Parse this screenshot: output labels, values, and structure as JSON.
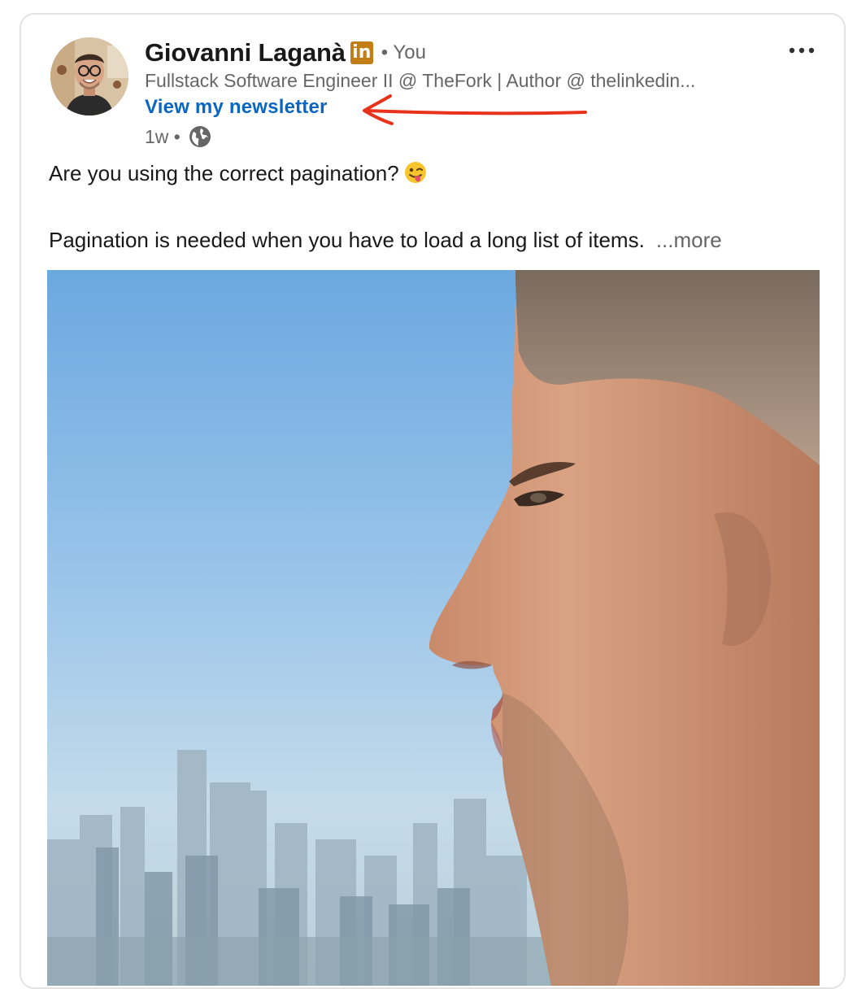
{
  "post": {
    "author": {
      "name": "Giovanni Laganà",
      "badge": "in",
      "degree": "• You",
      "headline": "Fullstack Software Engineer II @ TheFork | Author @ thelinkedin...",
      "newsletter_link": "View my newsletter"
    },
    "meta": {
      "age": "1w •",
      "visibility_icon": "globe-icon"
    },
    "menu_icon": "more-horizontal-icon",
    "text_line1": "Are you using the correct pagination?",
    "text_line1_emoji": "winking-face-with-tongue",
    "text_line2": "Pagination is needed when you have to load a long list of items.",
    "see_more": "...more"
  },
  "colors": {
    "link": "#0a66c2",
    "badge": "#c37d16",
    "annotation_arrow": "#e8321c",
    "secondary_text": "#666666"
  }
}
